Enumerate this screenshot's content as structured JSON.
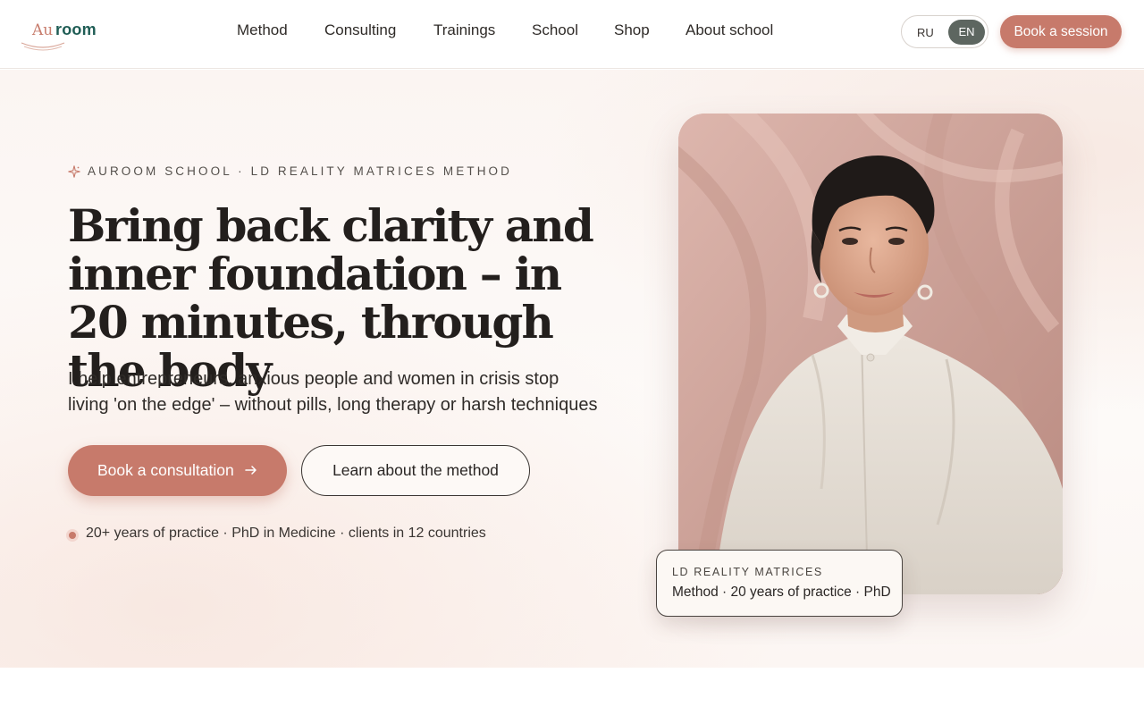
{
  "logo": {
    "part1": "Au",
    "part2": "room"
  },
  "nav": {
    "items": [
      {
        "label": "Method"
      },
      {
        "label": "Consulting"
      },
      {
        "label": "Trainings"
      },
      {
        "label": "School"
      },
      {
        "label": "Shop"
      },
      {
        "label": "About school"
      }
    ]
  },
  "language": {
    "ru": "RU",
    "en": "EN",
    "selected": "EN"
  },
  "header_cta": "Book a session",
  "hero": {
    "eyebrow": "AUROOM SCHOOL · LD REALITY MATRICES METHOD",
    "headline": "Bring back clarity and inner foundation – in 20 minutes, through the body",
    "subtext": "I help entrepreneurs, anxious people and women in crisis stop living 'on the edge' – without pills, long therapy or harsh techniques",
    "primary_cta": "Book a consultation",
    "secondary_cta": "Learn about the method",
    "stats": "20+ years of practice · PhD in Medicine · clients in 12 countries"
  },
  "caption_card": {
    "eyebrow": "LD REALITY MATRICES",
    "text": "Method · 20 years of practice · PhD"
  },
  "colors": {
    "accent": "#c77a6b",
    "brand_teal": "#1f5d55",
    "toggle_active": "#5d6660"
  },
  "icons": [
    "sparkle-icon",
    "arrow-right-icon",
    "status-dot-icon"
  ]
}
